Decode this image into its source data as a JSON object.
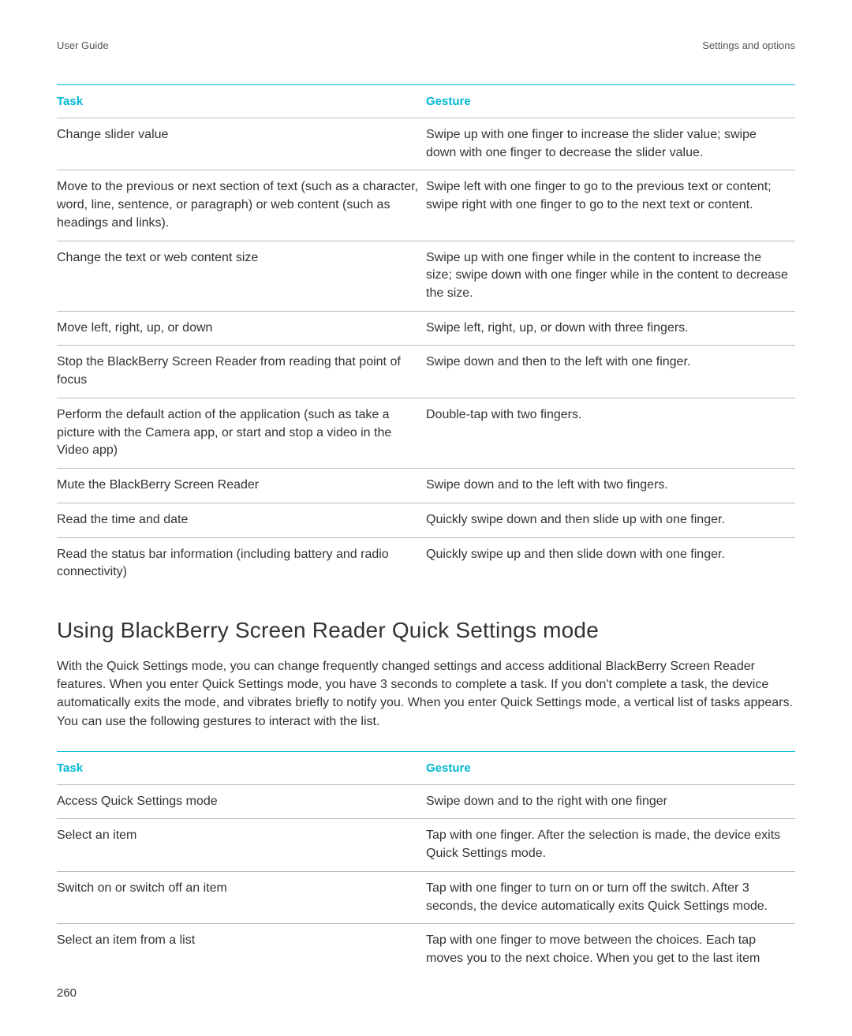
{
  "header": {
    "left": "User Guide",
    "right": "Settings and options"
  },
  "table1": {
    "headers": [
      "Task",
      "Gesture"
    ],
    "rows": [
      {
        "task": "Change slider value",
        "gesture": "Swipe up with one finger to increase the slider value; swipe down with one finger to decrease the slider value."
      },
      {
        "task": "Move to the previous or next section of text (such as a character, word, line, sentence, or paragraph) or web content (such as headings and links).",
        "gesture": "Swipe left with one finger to go to the previous text or content; swipe right with one finger to go to the next text or content."
      },
      {
        "task": "Change the text or web content size",
        "gesture": "Swipe up with one finger while in the content to increase the size; swipe down with one finger while in the content to decrease the size."
      },
      {
        "task": "Move left, right, up, or down",
        "gesture": "Swipe left, right, up, or down with three fingers."
      },
      {
        "task": "Stop the BlackBerry Screen Reader from reading that point of focus",
        "gesture": "Swipe down and then to the left with one finger."
      },
      {
        "task": "Perform the default action of the application (such as take a picture with the Camera app, or start and stop a video in the Video app)",
        "gesture": "Double-tap with two fingers."
      },
      {
        "task": "Mute the BlackBerry Screen Reader",
        "gesture": "Swipe down and to the left with two fingers."
      },
      {
        "task": "Read the time and date",
        "gesture": "Quickly swipe down and then slide up with one finger."
      },
      {
        "task": "Read the status bar information (including battery and radio connectivity)",
        "gesture": "Quickly swipe up and then slide down with one finger."
      }
    ]
  },
  "section": {
    "heading": "Using BlackBerry Screen Reader Quick Settings mode",
    "paragraph": "With the Quick Settings mode, you can change frequently changed settings and access additional BlackBerry Screen Reader features. When you enter Quick Settings mode, you have 3 seconds to complete a task. If you don't complete a task, the device automatically exits the mode, and vibrates briefly to notify you. When you enter Quick Settings mode, a vertical list of tasks appears. You can use the following gestures to interact with the list."
  },
  "table2": {
    "headers": [
      "Task",
      "Gesture"
    ],
    "rows": [
      {
        "task": "Access Quick Settings mode",
        "gesture": "Swipe down and to the right with one finger"
      },
      {
        "task": "Select an item",
        "gesture": "Tap with one finger. After the selection is made, the device exits Quick Settings mode."
      },
      {
        "task": "Switch on or switch off an item",
        "gesture": "Tap with one finger to turn on or turn off the switch. After 3 seconds, the device automatically exits Quick Settings mode."
      },
      {
        "task": "Select an item from a list",
        "gesture": "Tap with one finger to move between the choices. Each tap moves you to the next choice. When you get to the last item"
      }
    ]
  },
  "pageNumber": "260"
}
